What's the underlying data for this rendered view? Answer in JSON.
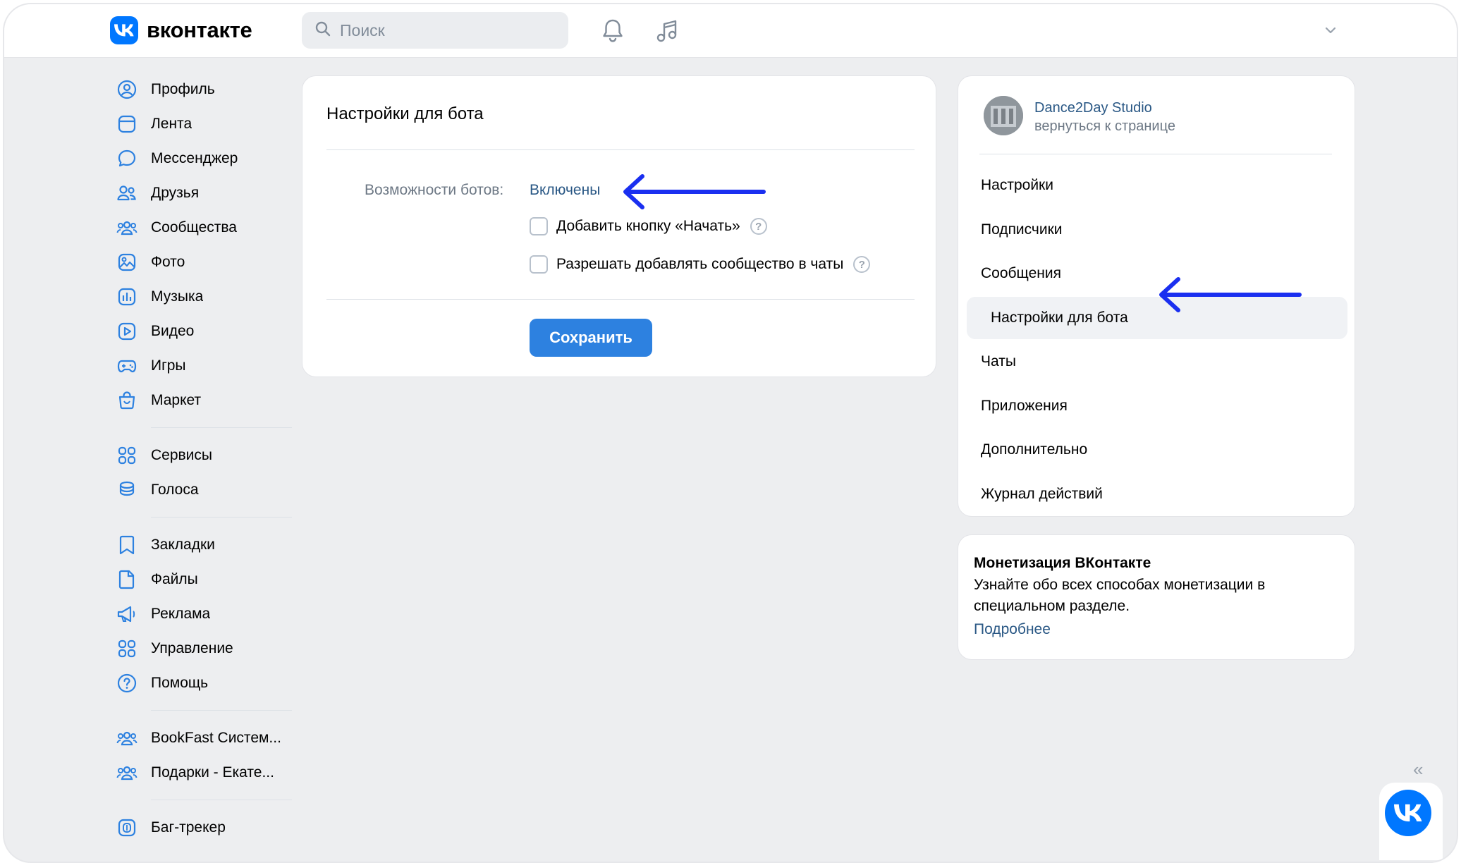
{
  "header": {
    "brand": "вконтакте",
    "search_placeholder": "Поиск"
  },
  "nav": {
    "group1": [
      {
        "label": "Профиль",
        "icon": "profile-icon"
      },
      {
        "label": "Лента",
        "icon": "feed-icon"
      },
      {
        "label": "Мессенджер",
        "icon": "messenger-icon"
      },
      {
        "label": "Друзья",
        "icon": "friends-icon"
      },
      {
        "label": "Сообщества",
        "icon": "communities-icon"
      },
      {
        "label": "Фото",
        "icon": "photo-icon"
      },
      {
        "label": "Музыка",
        "icon": "music-icon"
      },
      {
        "label": "Видео",
        "icon": "video-icon"
      },
      {
        "label": "Игры",
        "icon": "games-icon"
      },
      {
        "label": "Маркет",
        "icon": "market-icon"
      }
    ],
    "group2": [
      {
        "label": "Сервисы",
        "icon": "services-icon"
      },
      {
        "label": "Голоса",
        "icon": "votes-icon"
      }
    ],
    "group3": [
      {
        "label": "Закладки",
        "icon": "bookmark-icon"
      },
      {
        "label": "Файлы",
        "icon": "files-icon"
      },
      {
        "label": "Реклама",
        "icon": "ads-icon"
      },
      {
        "label": "Управление",
        "icon": "manage-icon"
      },
      {
        "label": "Помощь",
        "icon": "help-icon"
      }
    ],
    "group4": [
      {
        "label": "BookFast Систем...",
        "icon": "community-icon"
      },
      {
        "label": "Подарки - Екате...",
        "icon": "community-icon"
      }
    ],
    "group5": [
      {
        "label": "Баг-трекер",
        "icon": "bugtracker-icon"
      }
    ]
  },
  "main": {
    "title": "Настройки для бота",
    "bot_label": "Возможности ботов:",
    "bot_value": "Включены",
    "option_start": "Добавить кнопку «Начать»",
    "option_chats": "Разрешать добавлять сообщество в чаты",
    "help_glyph": "?",
    "save_label": "Сохранить"
  },
  "side": {
    "group_name": "Dance2Day Studio",
    "back_link": "вернуться к странице",
    "menu": [
      "Настройки",
      "Подписчики",
      "Сообщения",
      "Настройки для бота",
      "Чаты",
      "Приложения",
      "Дополнительно",
      "Журнал действий"
    ],
    "active_index": 3
  },
  "monetization": {
    "title": "Монетизация ВКонтакте",
    "description": "Узнайте обо всех способах монетизации в специальном разделе.",
    "link": "Подробнее"
  },
  "widgets": {
    "collapse_glyph": "«"
  },
  "colors": {
    "accent": "#0077ff",
    "link": "#2a5885",
    "button": "#2d81e0",
    "annotation_arrow": "#1a2ff0",
    "background": "#edeef0"
  }
}
